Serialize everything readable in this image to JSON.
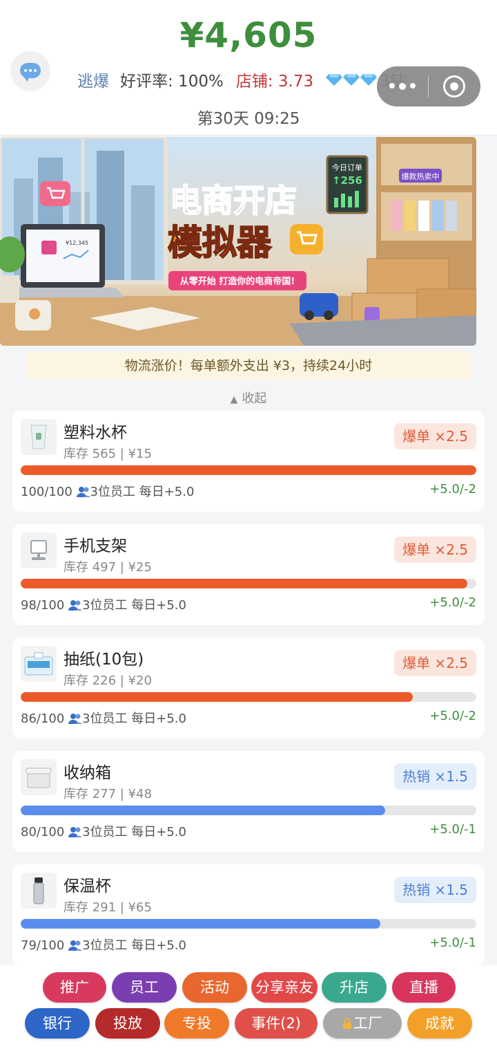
{
  "header": {
    "money": "¥4,605",
    "status": "逃爆",
    "rating": "好评率: 100%",
    "shop": "店铺: 3.73",
    "diamonds": "3钻",
    "day_time": "第30天 09:25"
  },
  "banner": {
    "title_line1": "电商开店",
    "title_line2": "模拟器",
    "subtitle": "从零开始  打造你的电商帝国!",
    "orders_label": "今日订单",
    "orders_value": "↑256",
    "hot_tag": "爆款热卖中",
    "laptop_price": "¥12,345"
  },
  "notice": "物流涨价！每单额外支出 ¥3，持续24小时",
  "collapse": {
    "icon": "▲",
    "label": "收起"
  },
  "products": [
    {
      "name": "塑料水杯",
      "info": "库存 565 | ¥15",
      "badge": "爆单 ×2.5",
      "badge_type": "hot",
      "progress": 100,
      "progress_text": "100/100",
      "staff": "3位员工 每日+5.0",
      "delta": "+5.0/-2",
      "icon": "cup-icon"
    },
    {
      "name": "手机支架",
      "info": "库存 497 | ¥25",
      "badge": "爆单 ×2.5",
      "badge_type": "hot",
      "progress": 98,
      "progress_text": "98/100",
      "staff": "3位员工 每日+5.0",
      "delta": "+5.0/-2",
      "icon": "phone-stand-icon"
    },
    {
      "name": "抽纸(10包)",
      "info": "库存 226 | ¥20",
      "badge": "爆单 ×2.5",
      "badge_type": "hot",
      "progress": 86,
      "progress_text": "86/100",
      "staff": "3位员工 每日+5.0",
      "delta": "+5.0/-2",
      "icon": "tissue-icon"
    },
    {
      "name": "收纳箱",
      "info": "库存 277 | ¥48",
      "badge": "热销 ×1.5",
      "badge_type": "sell",
      "progress": 80,
      "progress_text": "80/100",
      "staff": "3位员工 每日+5.0",
      "delta": "+5.0/-1",
      "icon": "storage-box-icon"
    },
    {
      "name": "保温杯",
      "info": "库存 291 | ¥65",
      "badge": "热销 ×1.5",
      "badge_type": "sell",
      "progress": 79,
      "progress_text": "79/100",
      "staff": "3位员工 每日+5.0",
      "delta": "+5.0/-1",
      "icon": "thermos-icon"
    }
  ],
  "buttons": {
    "row1": [
      {
        "label": "推广",
        "color": "#d83a5e"
      },
      {
        "label": "员工",
        "color": "#7a3eb0"
      },
      {
        "label": "活动",
        "color": "#e8672e"
      },
      {
        "label": "分享亲友",
        "color": "#e24848"
      },
      {
        "label": "升店",
        "color": "#3aa88e"
      },
      {
        "label": "直播",
        "color": "#d8345c"
      }
    ],
    "row2": [
      {
        "label": "银行",
        "color": "#2e66c8"
      },
      {
        "label": "投放",
        "color": "#b52a2a"
      },
      {
        "label": "专投",
        "color": "#ee7a2a"
      },
      {
        "label": "事件(2)",
        "color": "#e0504a"
      },
      {
        "label": "工厂",
        "color": "#a8a8a8"
      },
      {
        "label": "成就",
        "color": "#f2a02a"
      }
    ]
  }
}
